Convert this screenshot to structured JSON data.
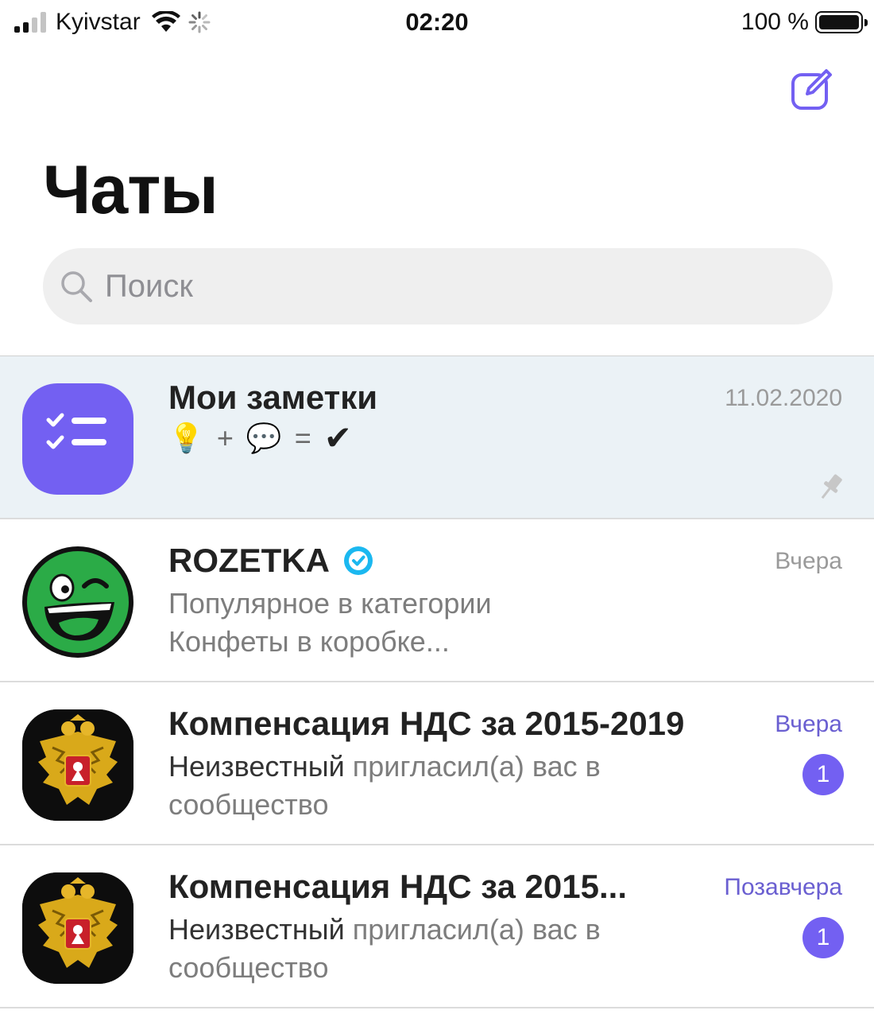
{
  "status_bar": {
    "carrier": "Kyivstar",
    "time": "02:20",
    "battery": "100 %"
  },
  "header": {
    "title": "Чаты",
    "compose_icon": "compose-icon"
  },
  "search": {
    "placeholder": "Поиск"
  },
  "colors": {
    "accent": "#7360f2",
    "pinned_background": "#ebf2f6",
    "verified": "#1bb8f0"
  },
  "chats": [
    {
      "name": "Мои заметки",
      "time": "11.02.2020",
      "preview_emoji": [
        "💡",
        "+",
        "💬",
        "=",
        "✔"
      ],
      "pinned": true,
      "avatar": "notes-checklist-icon"
    },
    {
      "name": "ROZETKA",
      "verified": true,
      "time": "Вчера",
      "preview": "Популярное в категории Конфеты в коробке...",
      "avatar": "rozetka-smiley-logo"
    },
    {
      "name": "Компенсация НДС за 2015-2019",
      "time": "Вчера",
      "preview_sender": "Неизвестный",
      "preview": "пригласил(а) вас в сообщество",
      "unread": "1",
      "avatar": "coat-of-arms-eagle"
    },
    {
      "name": "Компенсация НДС за 2015...",
      "time": "Позавчера",
      "preview_sender": "Неизвестный",
      "preview": "пригласил(а) вас в сообщество",
      "unread": "1",
      "avatar": "coat-of-arms-eagle"
    }
  ]
}
